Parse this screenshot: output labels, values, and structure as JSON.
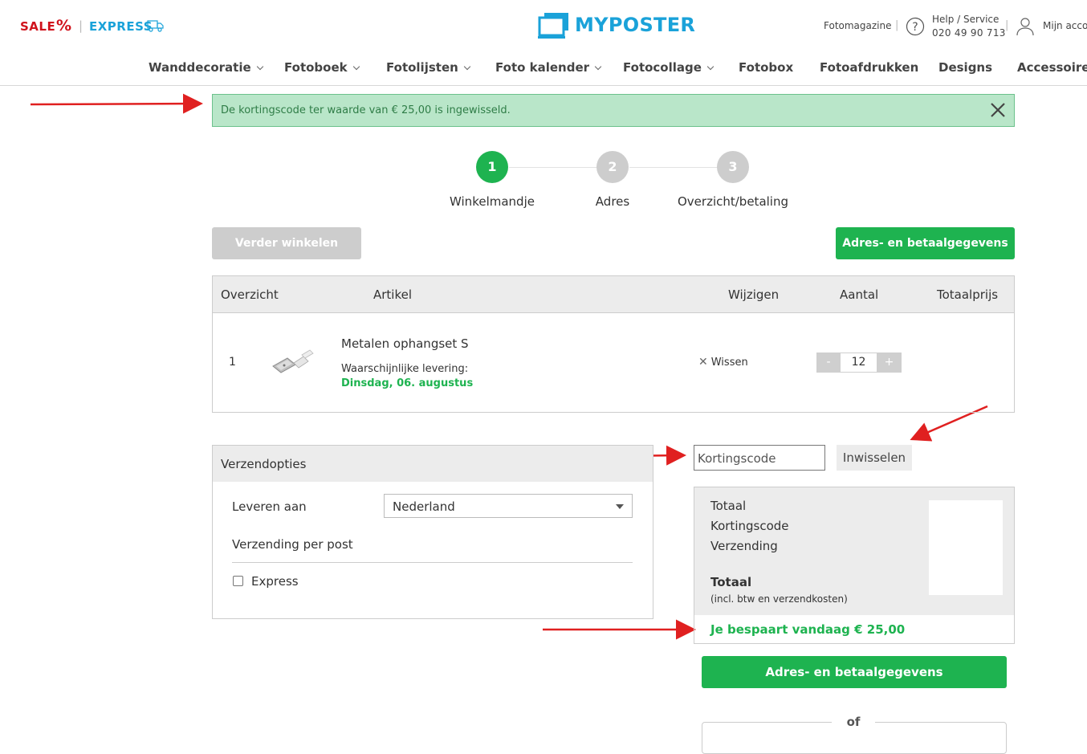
{
  "header": {
    "sale": "SALE",
    "sale_pct": "%",
    "express": "EXPRESS",
    "logo": "MYPOSTER",
    "fotomagazine": "Fotomagazine",
    "help_line1": "Help / Service",
    "help_line2": "020 49 90 713",
    "account": "Mijn acco",
    "nav": [
      "Wanddecoratie",
      "Fotoboek",
      "Fotolijsten",
      "Foto kalender",
      "Fotocollage",
      "Fotobox",
      "Fotoafdrukken",
      "Designs",
      "Accessoires"
    ]
  },
  "alert": {
    "text": "De kortingscode ter waarde van € 25,00 is ingewisseld."
  },
  "steps": [
    {
      "num": "1",
      "label": "Winkelmandje"
    },
    {
      "num": "2",
      "label": "Adres"
    },
    {
      "num": "3",
      "label": "Overzicht/betaling"
    }
  ],
  "buttons": {
    "continue_shopping": "Verder winkelen",
    "address_payment": "Adres- en betaalgegevens"
  },
  "cart": {
    "headers": [
      "Overzicht",
      "Artikel",
      "Wijzigen",
      "Aantal",
      "Totaalprijs"
    ],
    "item": {
      "num": "1",
      "name": "Metalen ophangset S",
      "delivery_label": "Waarschijnlijke levering:",
      "delivery_date": "Dinsdag, 06. augustus",
      "remove": "Wissen",
      "minus": "-",
      "qty": "12",
      "plus": "+"
    }
  },
  "shipping": {
    "title": "Verzendopties",
    "deliver_to": "Leveren aan",
    "country": "Nederland",
    "method": "Verzending per post",
    "express": "Express"
  },
  "coupon": {
    "placeholder": "Kortingscode",
    "redeem": "Inwisselen"
  },
  "totals": {
    "total": "Totaal",
    "coupon": "Kortingscode",
    "shipping": "Verzending",
    "grand_total": "Totaal",
    "incl": "(incl. btw en verzendkosten)",
    "savings": "Je bespaart vandaag € 25,00"
  },
  "or": "of",
  "colors": {
    "green": "#1eb350",
    "blue": "#1aa2d9",
    "red": "#d0121c",
    "arrow": "#e02020"
  }
}
